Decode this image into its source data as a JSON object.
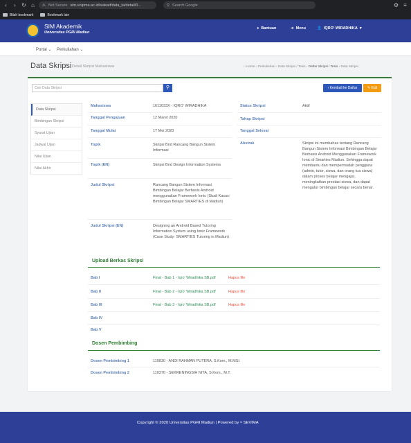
{
  "browser": {
    "not_secure": "Not Secure",
    "url": "sim.unipma.ac.id/siakad/data_ta/detail/0...",
    "search_placeholder": "Search Google",
    "bookmarks": [
      "Bilah bookmark",
      "Bookmark lain"
    ]
  },
  "app": {
    "name": "SIM Akademik",
    "university": "Universitas PGRI Madiun",
    "nav": {
      "help": "Bantuan",
      "menu": "Menu",
      "user": "IQRO' WIRADHIKA"
    }
  },
  "menubar": [
    "Portal",
    "Perkuliahan"
  ],
  "page": {
    "title": "Data Skripsi",
    "subtitle": "Detail Skripsi Mahasiswa",
    "breadcrumb": [
      "Home",
      "Perkuliahan",
      "Data Skripsi / Tesis",
      "Daftar Skripsi / Tesis",
      "Data Skripsi"
    ]
  },
  "toolbar": {
    "search_placeholder": "Cari Data Skripsi",
    "back_label": "Kembali ke Daftar",
    "edit_label": "Edit"
  },
  "sidebar": [
    "Data Skripsi",
    "Bimbingan Skripsi",
    "Syarat Ujian",
    "Jadwal Ujian",
    "Nilai Ujian",
    "Nilai Akhir"
  ],
  "detail": {
    "mahasiswa": {
      "label": "Mahasiswa",
      "value": "1611033X - IQRO' WIRADHIKA"
    },
    "tgl_pengajuan": {
      "label": "Tanggal Pengajuan",
      "value": "12 Maret 2020"
    },
    "tgl_mulai": {
      "label": "Tanggal Mulai",
      "value": "17 Mei 2020"
    },
    "topik": {
      "label": "Topik",
      "value": "Skripsi Bnd Rancang Bangun Sistem Informasi"
    },
    "topik_en": {
      "label": "Topik (EN)",
      "value": "Skripsi Bnd Design Information Systems"
    },
    "judul": {
      "label": "Judul Skripsi",
      "value": "Rancang Bangun Sistem Informasi Bimbingan Belajar Berbasis Android menggunakan Framework Ionic (Studi Kasus: Bimbingan Belajar SMARTIES di Madiun)"
    },
    "judul_en": {
      "label": "Judul Skripsi (EN)",
      "value": "Designing an Android Based Tutoring Information System using Ionic Framework (Case Study: SMARTIES Tutoring in Madiun)"
    },
    "status": {
      "label": "Status Skripsi",
      "value": "Aktif"
    },
    "tahap": {
      "label": "Tahap Skripsi",
      "value": ""
    },
    "tgl_selesai": {
      "label": "Tanggal Selesai",
      "value": ""
    },
    "abstrak": {
      "label": "Abstrak",
      "value": "Skripsi ini membahas tentang Rancang Bangun Sistem Informasi Bimbingan Belajar Berbasis Android Menggunakan Framework Ionic di Smarties Madiun. Sehingga dapat membantu dan mempermudah pengguna (admin, tutor, siswa, dan orang tua siswa) dalam proses belajar mengajar, meningkatkan prestasi siswa, dan dapat mengatur bimbingan belajar secara benar."
    }
  },
  "upload": {
    "title": "Upload Berkas Skripsi",
    "delete_label": "Hapus file",
    "rows": [
      {
        "label": "Bab I",
        "file": "Final - Bab 1 - Iqro' Wiradhika SB.pdf"
      },
      {
        "label": "Bab II",
        "file": "Final - Bab 2 - Iqro' Wiradhika SB.pdf"
      },
      {
        "label": "Bab III",
        "file": "Final - Bab 3 - Iqro' Wiradhika SB.pdf"
      },
      {
        "label": "Bab IV",
        "file": ""
      },
      {
        "label": "Bab V",
        "file": ""
      }
    ]
  },
  "dosen": {
    "title": "Dosen Pembimbing",
    "rows": [
      {
        "label": "Dosen Pembimbing 1",
        "value": "110830 - ANDI RAHMAN PUTERA, S.Kom., M.MSI."
      },
      {
        "label": "Dosen Pembimbing 2",
        "value": "110370 - SEKRENINGSIH NITA, S.Kom., M.T."
      }
    ]
  },
  "footer": {
    "text": "Copyright © 2020 Universitas PGRI Madiun | Powered by",
    "brand": "SEVIMA"
  },
  "colors": {
    "primary": "#2d3f96",
    "accent": "#2e7d32",
    "button": "#2d57b8",
    "warning": "#f39c12"
  }
}
